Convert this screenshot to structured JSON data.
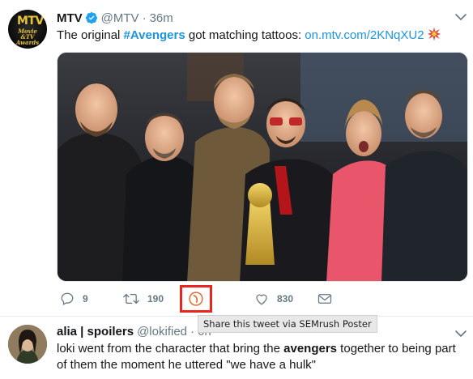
{
  "tweet1": {
    "name": "MTV",
    "handle": "@MTV",
    "separator": "·",
    "time": "36m",
    "avatar_lines": [
      "Movie",
      "&TV",
      "Awards"
    ],
    "avatar_logo": "MTV",
    "text_prefix": "The original ",
    "hashtag": "#Avengers",
    "text_middle": " got matching tattoos: ",
    "link": "on.mtv.com/2KNqXU2",
    "actions": {
      "reply_count": "9",
      "retweet_count": "190",
      "like_count": "830"
    }
  },
  "tooltip": "Share this tweet via SEMrush Poster",
  "tweet2": {
    "name": "alia | spoilers",
    "handle": "@lokified",
    "separator": "·",
    "time": "6h",
    "text_before": "loki went from the character that bring the ",
    "text_bold": "avengers",
    "text_after": " together to being part of them the moment he uttered \"we have a hulk\""
  },
  "colors": {
    "accent": "#1b95e0",
    "verified": "#1da1f2",
    "muted": "#657786",
    "highlight": "#e8261f"
  }
}
